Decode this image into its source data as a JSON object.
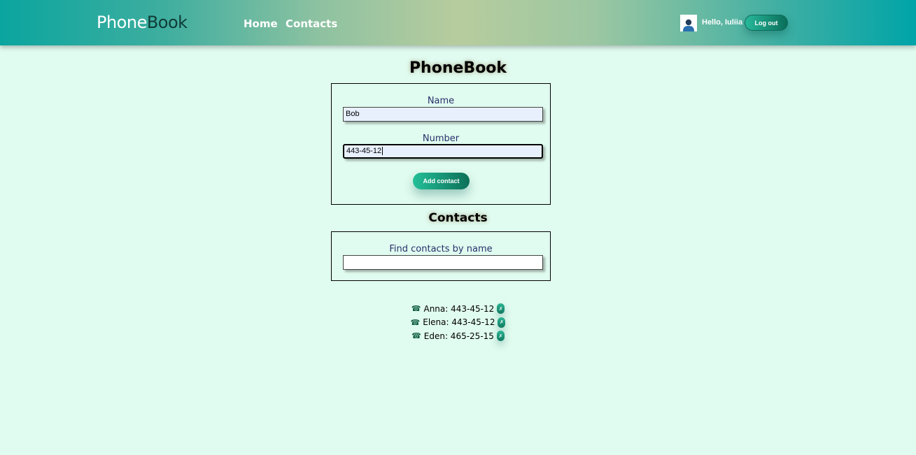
{
  "header": {
    "logo_part1": "Phone",
    "logo_part2": "Book",
    "nav": [
      {
        "label": "Home"
      },
      {
        "label": "Contacts"
      }
    ],
    "greeting": "Hello, Iuliia",
    "logout_label": "Log out"
  },
  "main": {
    "title": "PhoneBook",
    "form": {
      "name_label": "Name",
      "name_value": "Bob",
      "number_label": "Number",
      "number_value": "443-45-12",
      "add_label": "Add contact"
    },
    "contacts_title": "Contacts",
    "filter": {
      "label": "Find contacts by name",
      "value": ""
    },
    "contacts": [
      {
        "name": "Anna",
        "number": "443-45-12",
        "text": "Anna: 443-45-12"
      },
      {
        "name": "Elena",
        "number": "443-45-12",
        "text": "Elena: 443-45-12"
      },
      {
        "name": "Eden",
        "number": "465-25-15",
        "text": "Eden: 465-25-15"
      }
    ]
  },
  "icons": {
    "avatar": "user-avatar-icon",
    "phone": "phone-icon",
    "delete": "delete-icon"
  },
  "colors": {
    "background": "#e0fbef",
    "accent": "#0d6f57",
    "label_text": "#27306b"
  }
}
